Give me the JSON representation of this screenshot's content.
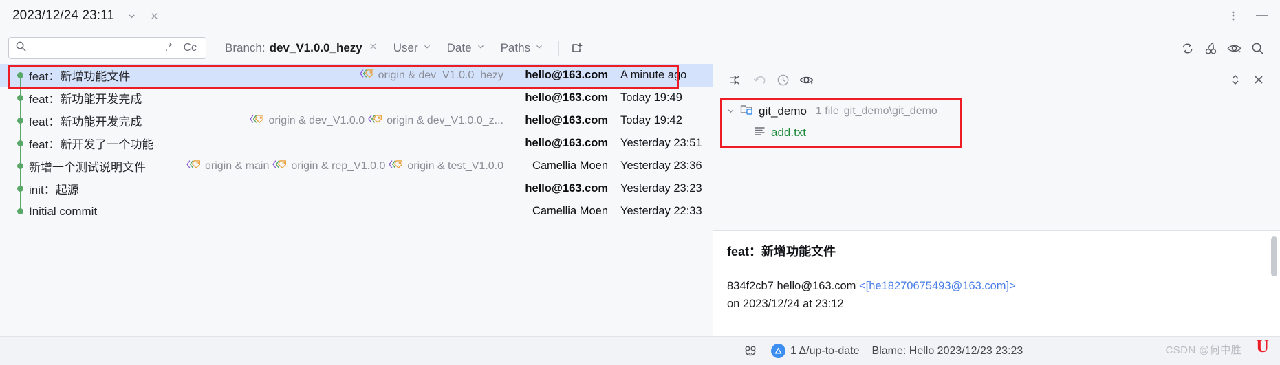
{
  "titlebar": {
    "tab_title": "2023/12/24 23:11",
    "dropdown_icon": "chevron-down-icon",
    "close_icon": "close-icon",
    "more_icon": "more-vertical-icon",
    "minimize_icon": "minimize-icon"
  },
  "toolbar": {
    "search_icon": "search-icon",
    "search_value": "",
    "search_placeholder": "",
    "regex_label": ".*",
    "case_label": "Cc",
    "filters": [
      {
        "label": "Branch:",
        "value": "dev_V1.0.0_hezy",
        "has_clear": true,
        "has_chevron": false,
        "name": "filter-branch"
      },
      {
        "label": "User",
        "value": "",
        "has_clear": false,
        "has_chevron": true,
        "name": "filter-user"
      },
      {
        "label": "Date",
        "value": "",
        "has_clear": false,
        "has_chevron": true,
        "name": "filter-date"
      },
      {
        "label": "Paths",
        "value": "",
        "has_clear": false,
        "has_chevron": true,
        "name": "filter-paths"
      }
    ],
    "new_tab_icon": "new-tab-icon",
    "right_icons": [
      {
        "name": "refresh-icon"
      },
      {
        "name": "cherry-pick-icon"
      },
      {
        "name": "show-details-eye-icon"
      },
      {
        "name": "search-icon"
      }
    ]
  },
  "commits": {
    "rows": [
      {
        "subject": "feat：新增功能文件",
        "refs": [
          {
            "text": "origin & dev_V1.0.0_hezy",
            "icon": "branch-label-icon"
          }
        ],
        "author": "hello@163.com",
        "author_bold": true,
        "date": "A minute ago",
        "selected": true
      },
      {
        "subject": "feat：新功能开发完成",
        "refs": [],
        "author": "hello@163.com",
        "author_bold": true,
        "date": "Today 19:49",
        "selected": false
      },
      {
        "subject": "feat：新功能开发完成",
        "refs": [
          {
            "text": "origin & dev_V1.0.0",
            "icon": "branch-label-icon"
          },
          {
            "text": "origin & dev_V1.0.0_z...",
            "icon": "branch-label-icon"
          }
        ],
        "author": "hello@163.com",
        "author_bold": true,
        "date": "Today 19:42",
        "selected": false
      },
      {
        "subject": "feat：新开发了一个功能",
        "refs": [],
        "author": "hello@163.com",
        "author_bold": true,
        "date": "Yesterday 23:51",
        "selected": false
      },
      {
        "subject": "新增一个测试说明文件",
        "refs": [
          {
            "text": "origin & main",
            "icon": "branch-label-icon"
          },
          {
            "text": "origin & rep_V1.0.0",
            "icon": "branch-label-icon"
          },
          {
            "text": "origin & test_V1.0.0",
            "icon": "branch-label-icon"
          }
        ],
        "author": "Camellia Moen",
        "author_bold": false,
        "date": "Yesterday 23:36",
        "selected": false
      },
      {
        "subject": "init：起源",
        "refs": [],
        "author": "hello@163.com",
        "author_bold": true,
        "date": "Yesterday 23:23",
        "selected": false
      },
      {
        "subject": "Initial commit",
        "refs": [],
        "author": "Camellia Moen",
        "author_bold": false,
        "date": "Yesterday 22:33",
        "selected": false
      }
    ]
  },
  "changes": {
    "toolbar_icons": [
      {
        "name": "group-by-icon"
      },
      {
        "name": "revert-icon"
      },
      {
        "name": "history-icon"
      },
      {
        "name": "show-diff-eye-icon"
      }
    ],
    "expand_icon": "expand-collapse-icon",
    "close_icon": "close-icon",
    "tree": {
      "root": {
        "chevron": "chevron-down-icon",
        "icon": "module-folder-icon",
        "name": "git_demo",
        "file_count": "1 file",
        "path": "git_demo\\git_demo"
      },
      "files": [
        {
          "icon": "text-file-icon",
          "name": "add.txt",
          "color": "#1e8a3c"
        }
      ]
    }
  },
  "detail": {
    "subject": "feat：新增功能文件",
    "hash": "834f2cb7",
    "author": "hello@163.com",
    "email": "<[he18270675493@163.com]>",
    "on_line": "on 2023/12/24 at 23:12"
  },
  "statusbar": {
    "branch_icon": "git-branch-icon",
    "changes_text": "1 Δ/up-to-date",
    "blame_text": "Blame: Hello 2023/12/23 23:23",
    "watermark": "CSDN @何中胜",
    "logo": "U"
  },
  "colors": {
    "selection": "#d4e2fc",
    "annotation": "#ee1c24",
    "graph_green": "#59a869",
    "file_green": "#1e8a3c",
    "link_blue": "#4a7ee8"
  }
}
